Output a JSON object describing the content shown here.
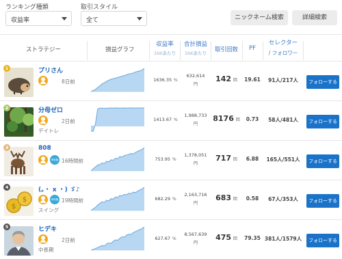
{
  "filters": {
    "ranking_label": "ランキング種類",
    "ranking_value": "収益率",
    "style_label": "取引スタイル",
    "style_value": "全て",
    "nickname_search": "ニックネーム検索",
    "detail_search": "詳細検索"
  },
  "columns": {
    "strategy": "ストラテジー",
    "graph": "損益グラフ",
    "return_rate": "収益率",
    "return_rate_sub": "1lotあたり",
    "total_pl": "合計損益",
    "total_pl_sub": "1lotあたり",
    "trades": "取引回数",
    "pf": "PF",
    "selector_line1": "セレクター",
    "selector_line2": "/ フォロワー"
  },
  "rows": [
    {
      "rank": "1",
      "rank_color": "#e6b422",
      "name": "プリさん",
      "badge": "",
      "ago": "8日前",
      "style": "",
      "return_rate": "1636.35",
      "pct": "%",
      "total_pl": "632,614",
      "yen": "円",
      "trades": "142",
      "kai": "回",
      "pf": "19.61",
      "selector": "91人/217人",
      "follow": "フォローする",
      "avatar": "hedgehog",
      "chart_data": {
        "type": "area",
        "values": [
          0,
          4,
          8,
          16,
          22,
          30,
          34,
          40,
          44,
          48,
          50,
          52,
          55,
          57,
          60,
          62,
          65,
          68,
          70,
          72,
          76,
          78,
          80,
          84,
          90
        ]
      }
    },
    {
      "rank": "2",
      "rank_color": "#a8c96a",
      "name": "分母ゼロ",
      "badge": "",
      "ago": "2日前",
      "style": "デイトレ",
      "return_rate": "1413.67",
      "pct": "%",
      "total_pl": "1,988,733",
      "yen": "円",
      "trades": "8176",
      "kai": "回",
      "pf": "0.73",
      "selector": "58人/481人",
      "follow": "フォローする",
      "avatar": "forest",
      "chart_data": {
        "type": "area",
        "values": [
          -25,
          -25,
          10,
          82,
          86,
          86,
          85,
          86,
          86,
          87,
          86,
          87,
          87,
          86,
          87,
          87,
          86,
          87,
          87,
          87,
          86,
          87,
          87,
          87,
          87
        ]
      }
    },
    {
      "rank": "3",
      "rank_color": "#e4b878",
      "name": "808",
      "badge": "有料版",
      "ago": "16時間前",
      "style": "",
      "return_rate": "753.95",
      "pct": "%",
      "total_pl": "1,378,051",
      "yen": "円",
      "trades": "717",
      "kai": "回",
      "pf": "6.88",
      "selector": "165人/551人",
      "follow": "フォローする",
      "avatar": "moose",
      "chart_data": {
        "type": "area",
        "values": [
          0,
          8,
          15,
          22,
          24,
          30,
          28,
          36,
          34,
          42,
          40,
          48,
          46,
          54,
          52,
          58,
          60,
          62,
          66,
          64,
          70,
          74,
          78,
          82,
          88
        ]
      }
    },
    {
      "rank": "4",
      "rank_color": "#555555",
      "name": "(。・ x ・) ゞ♪",
      "badge": "有料版",
      "ago": "19時間前",
      "style": "スイング",
      "return_rate": "682.29",
      "pct": "%",
      "total_pl": "2,163,716",
      "yen": "円",
      "trades": "683",
      "kai": "回",
      "pf": "0.58",
      "selector": "67人/353人",
      "follow": "フォローする",
      "avatar": "coins",
      "chart_data": {
        "type": "area",
        "values": [
          0,
          6,
          12,
          20,
          26,
          32,
          30,
          38,
          36,
          44,
          42,
          50,
          48,
          56,
          54,
          60,
          58,
          64,
          62,
          68,
          66,
          72,
          76,
          80,
          86
        ]
      }
    },
    {
      "rank": "5",
      "rank_color": "#555555",
      "name": "ヒデキ",
      "badge": "",
      "ago": "2日前",
      "style": "中長期",
      "return_rate": "627.67",
      "pct": "%",
      "total_pl": "8,567,639",
      "yen": "円",
      "trades": "475",
      "kai": "回",
      "pf": "79.35",
      "selector": "381人/1579人",
      "follow": "フォローする",
      "avatar": "man",
      "chart_data": {
        "type": "area",
        "values": [
          0,
          3,
          6,
          10,
          14,
          18,
          16,
          24,
          28,
          26,
          34,
          40,
          38,
          46,
          52,
          50,
          58,
          62,
          60,
          68,
          72,
          76,
          80,
          84,
          90
        ]
      }
    }
  ]
}
